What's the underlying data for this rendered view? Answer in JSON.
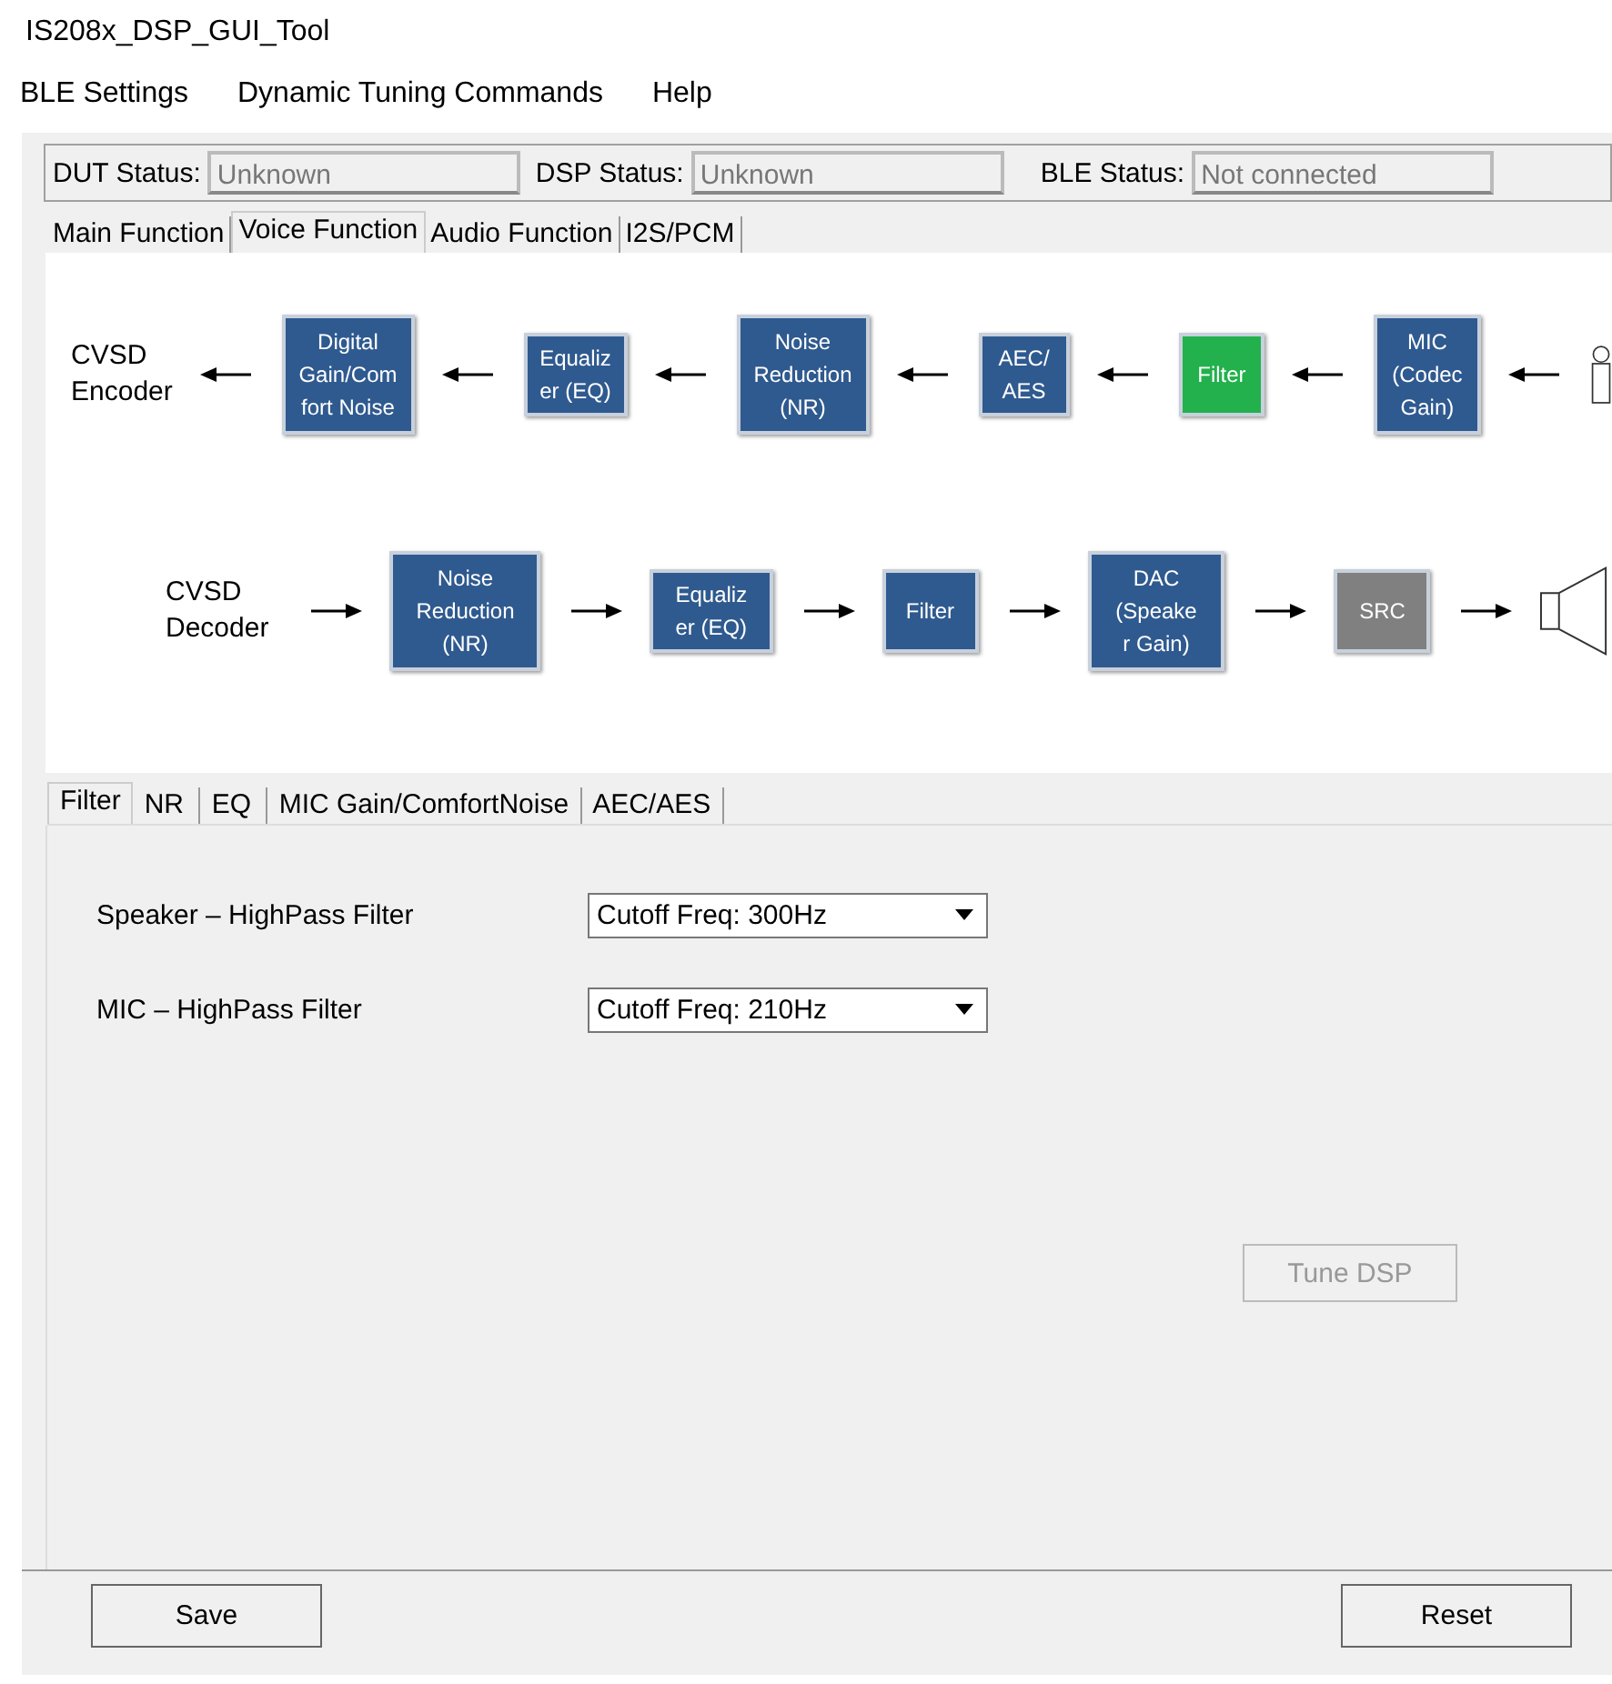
{
  "window": {
    "title": "IS208x_DSP_GUI_Tool"
  },
  "menu": [
    "BLE Settings",
    "Dynamic Tuning Commands",
    "Help"
  ],
  "status": [
    {
      "label": "DUT Status:",
      "value": "Unknown",
      "disabled": true
    },
    {
      "label": "DSP Status:",
      "value": "Unknown",
      "disabled": true
    },
    {
      "label": "BLE Status:",
      "value": "Not connected",
      "disabled": true
    }
  ],
  "tabs": [
    {
      "label": "Main Function",
      "selected": false
    },
    {
      "label": "Voice Function",
      "selected": true
    },
    {
      "label": "Audio Function",
      "selected": false
    },
    {
      "label": "I2S/PCM",
      "selected": false
    }
  ],
  "diagram": {
    "rows": [
      {
        "label": "CVSD\nEncoder",
        "kind": "encoder",
        "blocks": [
          {
            "text": "Digital\nGain/Com\nfort Noise",
            "color": "#2f5a8f"
          },
          {
            "text": "Equaliz\ner (EQ)",
            "color": "#2f5a8f"
          },
          {
            "text": "Noise\nReduction\n(NR)",
            "color": "#2f5a8f"
          },
          {
            "text": "AEC/\nAES",
            "color": "#2f5a8f"
          },
          {
            "text": "Filter",
            "color": "#22b14c"
          },
          {
            "text": "MIC\n(Codec\nGain)",
            "color": "#2f5a8f"
          }
        ]
      },
      {
        "label": "CVSD\nDecoder",
        "kind": "decoder",
        "blocks": [
          {
            "text": "Noise\nReduction\n(NR)",
            "color": "#2f5a8f"
          },
          {
            "text": "Equaliz\ner (EQ)",
            "color": "#2f5a8f"
          },
          {
            "text": "Filter",
            "color": "#2f5a8f"
          },
          {
            "text": "DAC\n(Speake\nr Gain)",
            "color": "#2f5a8f"
          },
          {
            "text": "SRC",
            "color": "#808080"
          }
        ]
      }
    ]
  },
  "subtabs": [
    {
      "label": "Filter",
      "selected": true
    },
    {
      "label": "NR",
      "selected": false
    },
    {
      "label": "EQ",
      "selected": false
    },
    {
      "label": "MIC Gain/ComfortNoise",
      "selected": false
    },
    {
      "label": "AEC/AES",
      "selected": false
    }
  ],
  "settings": [
    {
      "label": "Speaker – HighPass Filter",
      "value": "Cutoff Freq: 300Hz"
    },
    {
      "label": "MIC – HighPass Filter",
      "value": "Cutoff Freq: 210Hz"
    }
  ],
  "tune_button": {
    "label": "Tune DSP",
    "disabled": true
  },
  "buttons": [
    "Save",
    "Reset"
  ]
}
